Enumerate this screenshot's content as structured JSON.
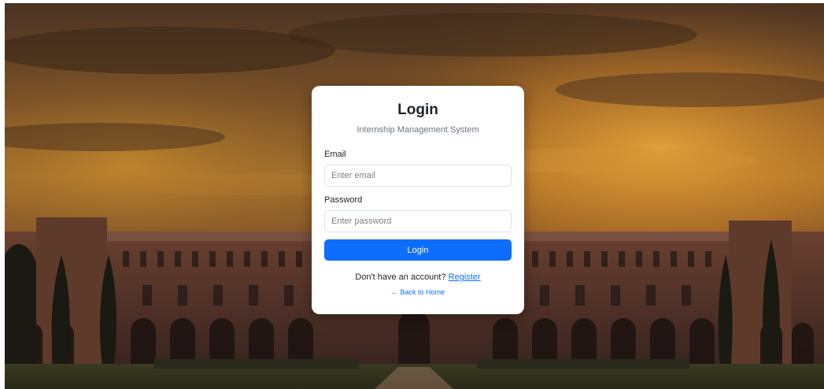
{
  "login": {
    "title": "Login",
    "subtitle": "Internship Management System",
    "email_label": "Email",
    "email_placeholder": "Enter email",
    "email_value": "",
    "password_label": "Password",
    "password_placeholder": "Enter password",
    "password_value": "",
    "submit_label": "Login",
    "register_prompt": "Don't have an account?",
    "register_link": "Register",
    "back_link": "← Back to Home"
  },
  "colors": {
    "primary": "#0d6efd",
    "card_background": "#ffffff",
    "sky_glow": "#c98a2c",
    "building_brick": "#5a3526"
  },
  "background": {
    "scene": "campus-building-at-sunset"
  }
}
